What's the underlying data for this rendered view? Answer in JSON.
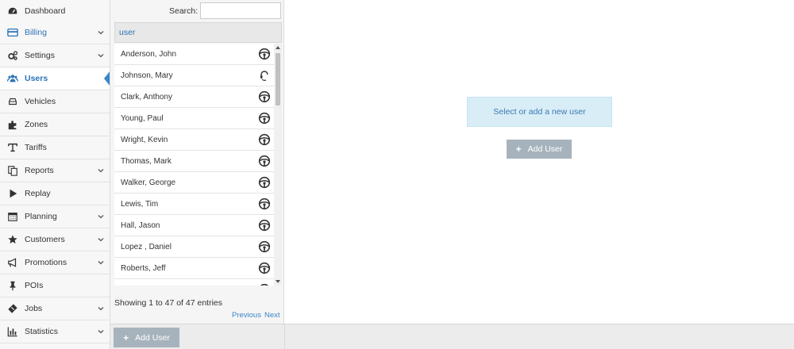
{
  "sidebar": {
    "items": [
      {
        "label": "Dashboard",
        "icon": "dashboard-icon"
      },
      {
        "label": "Billing",
        "icon": "credit-card-icon"
      },
      {
        "label": "Settings",
        "icon": "cogs-icon"
      },
      {
        "label": "Users",
        "icon": "users-icon"
      },
      {
        "label": "Vehicles",
        "icon": "car-icon"
      },
      {
        "label": "Zones",
        "icon": "puzzle-icon"
      },
      {
        "label": "Tariffs",
        "icon": "text-icon"
      },
      {
        "label": "Reports",
        "icon": "copy-icon"
      },
      {
        "label": "Replay",
        "icon": "play-icon"
      },
      {
        "label": "Planning",
        "icon": "calendar-icon"
      },
      {
        "label": "Customers",
        "icon": "star-icon"
      },
      {
        "label": "Promotions",
        "icon": "bullhorn-icon"
      },
      {
        "label": "POIs",
        "icon": "pushpin-icon"
      },
      {
        "label": "Jobs",
        "icon": "ticket-icon"
      },
      {
        "label": "Statistics",
        "icon": "bar-chart-icon"
      }
    ],
    "active": "Users"
  },
  "list": {
    "search_label": "Search:",
    "search_value": "",
    "column_header": "user",
    "rows": [
      {
        "name": "Anderson, John",
        "icon": "steering-wheel-icon"
      },
      {
        "name": "Johnson, Mary",
        "icon": "headset-icon"
      },
      {
        "name": "Clark, Anthony",
        "icon": "steering-wheel-icon"
      },
      {
        "name": "Young, Paul",
        "icon": "steering-wheel-icon"
      },
      {
        "name": "Wright, Kevin",
        "icon": "steering-wheel-icon"
      },
      {
        "name": "Thomas, Mark",
        "icon": "steering-wheel-icon"
      },
      {
        "name": "Walker, George",
        "icon": "steering-wheel-icon"
      },
      {
        "name": "Lewis, Tim",
        "icon": "steering-wheel-icon"
      },
      {
        "name": "Hall, Jason",
        "icon": "steering-wheel-icon"
      },
      {
        "name": "Lopez , Daniel",
        "icon": "steering-wheel-icon"
      },
      {
        "name": "Roberts, Jeff",
        "icon": "steering-wheel-icon"
      },
      {
        "name": "",
        "icon": "steering-wheel-icon"
      }
    ],
    "info": "Showing 1 to 47 of 47 entries",
    "previous": "Previous",
    "next": "Next"
  },
  "bottom": {
    "add_user": "Add User"
  },
  "main": {
    "notice": "Select or add a new user",
    "add_user": "Add User"
  },
  "colors": {
    "accent": "#2a74b7",
    "button": "#a6b3bd",
    "notice_bg": "#d9edf7"
  }
}
